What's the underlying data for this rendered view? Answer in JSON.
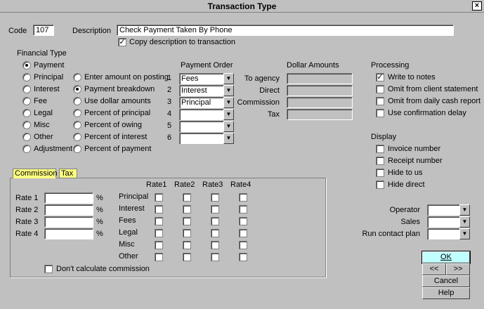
{
  "window": {
    "title": "Transaction Type",
    "close": "×"
  },
  "header": {
    "code_label": "Code",
    "code_value": "107",
    "description_label": "Description",
    "description_value": "Check Payment Taken By Phone",
    "copy_desc_label": "Copy description to transaction",
    "copy_desc_checked": true
  },
  "financial_type": {
    "label": "Financial Type",
    "options": [
      {
        "label": "Payment",
        "selected": true
      },
      {
        "label": "Principal",
        "selected": false
      },
      {
        "label": "Interest",
        "selected": false
      },
      {
        "label": "Fee",
        "selected": false
      },
      {
        "label": "Legal",
        "selected": false
      },
      {
        "label": "Misc",
        "selected": false
      },
      {
        "label": "Other",
        "selected": false
      },
      {
        "label": "Adjustment",
        "selected": false
      }
    ]
  },
  "amount_mode": {
    "options": [
      {
        "label": "Enter amount on posting",
        "selected": false
      },
      {
        "label": "Payment breakdown",
        "selected": true
      },
      {
        "label": "Use dollar amounts",
        "selected": false
      },
      {
        "label": "Percent of principal",
        "selected": false
      },
      {
        "label": "Percent of owing",
        "selected": false
      },
      {
        "label": "Percent of interest",
        "selected": false
      },
      {
        "label": "Percent of payment",
        "selected": false
      }
    ]
  },
  "payment_order": {
    "label": "Payment Order",
    "rows": [
      {
        "num": "1",
        "value": "Fees"
      },
      {
        "num": "2",
        "value": "Interest"
      },
      {
        "num": "3",
        "value": "Principal"
      },
      {
        "num": "4",
        "value": ""
      },
      {
        "num": "5",
        "value": ""
      },
      {
        "num": "6",
        "value": ""
      }
    ]
  },
  "dollar_amounts": {
    "label": "Dollar Amounts",
    "rows": [
      {
        "label": "To agency",
        "value": ""
      },
      {
        "label": "Direct",
        "value": ""
      },
      {
        "label": "Commission",
        "value": ""
      },
      {
        "label": "Tax",
        "value": ""
      }
    ]
  },
  "processing": {
    "label": "Processing",
    "options": [
      {
        "label": "Write to notes",
        "checked": true
      },
      {
        "label": "Omit from client statement",
        "checked": false
      },
      {
        "label": "Omit from daily cash report",
        "checked": false
      },
      {
        "label": "Use confirmation delay",
        "checked": false
      }
    ]
  },
  "display": {
    "label": "Display",
    "options": [
      {
        "label": "Invoice number",
        "checked": false
      },
      {
        "label": "Receipt number",
        "checked": false
      },
      {
        "label": "Hide to us",
        "checked": false
      },
      {
        "label": "Hide direct",
        "checked": false
      }
    ]
  },
  "tabs": [
    {
      "label": "Commission",
      "active": true
    },
    {
      "label": "Tax",
      "active": false
    }
  ],
  "commission": {
    "rates": [
      {
        "label": "Rate 1",
        "unit": "%"
      },
      {
        "label": "Rate 2",
        "unit": "%"
      },
      {
        "label": "Rate 3",
        "unit": "%"
      },
      {
        "label": "Rate 4",
        "unit": "%"
      }
    ],
    "grid_columns": [
      "Rate1",
      "Rate2",
      "Rate3",
      "Rate4"
    ],
    "grid_rows": [
      "Principal",
      "Interest",
      "Fees",
      "Legal",
      "Misc",
      "Other"
    ],
    "dont_calc_label": "Don't calculate commission"
  },
  "operator_panel": {
    "rows": [
      {
        "label": "Operator",
        "value": ""
      },
      {
        "label": "Sales",
        "value": ""
      },
      {
        "label": "Run contact plan",
        "value": ""
      }
    ]
  },
  "buttons": {
    "ok": "OK",
    "prev": "<<",
    "next": ">>",
    "cancel": "Cancel",
    "help": "Help"
  },
  "icons": {
    "dropdown": "chevron-down-icon",
    "check": "checkmark-icon"
  }
}
